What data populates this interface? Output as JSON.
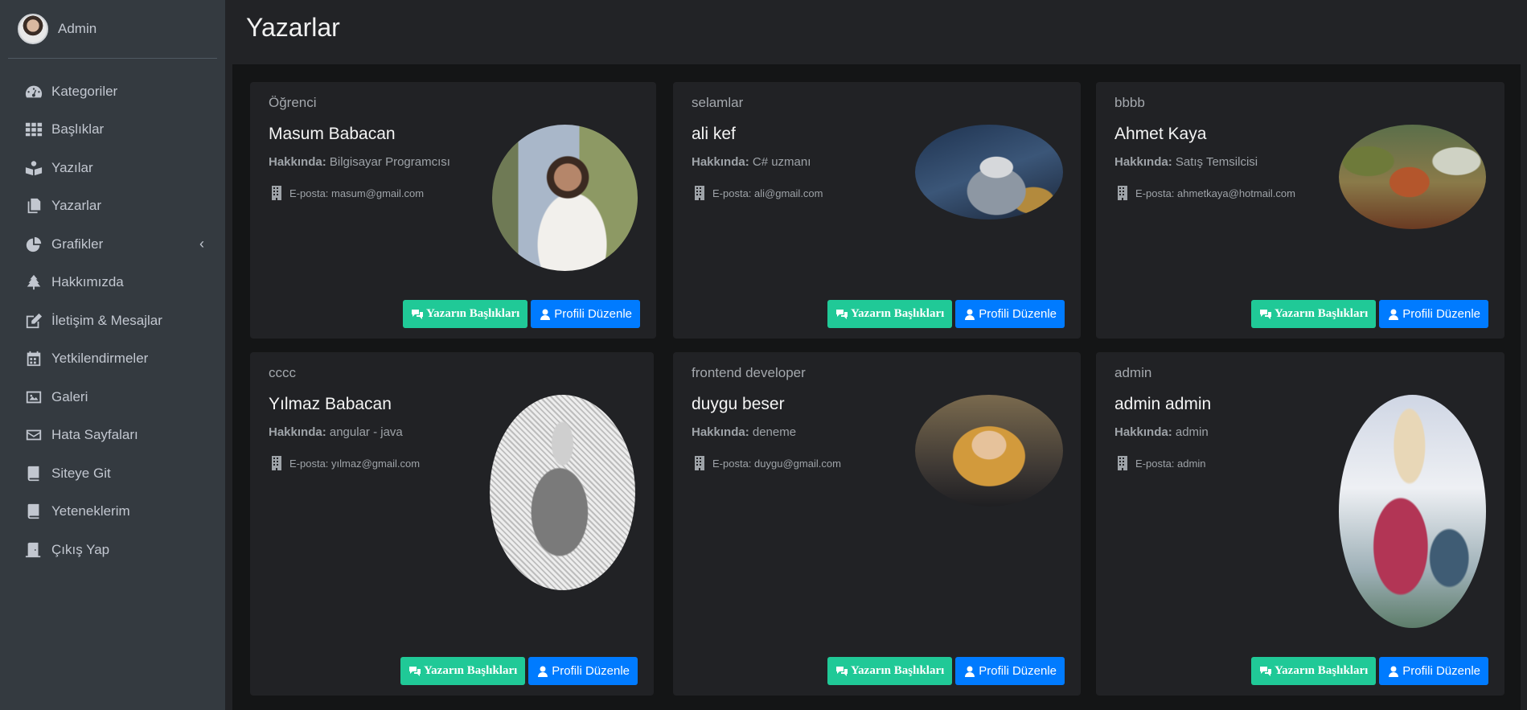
{
  "user": {
    "name": "Admin"
  },
  "nav": [
    {
      "label": "Kategoriler",
      "icon": "dashboard-icon"
    },
    {
      "label": "Başlıklar",
      "icon": "grid-icon"
    },
    {
      "label": "Yazılar",
      "icon": "book-reader-icon"
    },
    {
      "label": "Yazarlar",
      "icon": "copy-icon"
    },
    {
      "label": "Grafikler",
      "icon": "chart-pie-icon",
      "chevron": "‹"
    },
    {
      "label": "Hakkımızda",
      "icon": "tree-icon"
    },
    {
      "label": "İletişim & Mesajlar",
      "icon": "edit-icon"
    },
    {
      "label": "Yetkilendirmeler",
      "icon": "calendar-icon"
    },
    {
      "label": "Galeri",
      "icon": "image-icon"
    },
    {
      "label": "Hata Sayfaları",
      "icon": "envelope-icon"
    },
    {
      "label": "Siteye Git",
      "icon": "book-icon"
    },
    {
      "label": "Yeteneklerim",
      "icon": "book-icon"
    },
    {
      "label": "Çıkış Yap",
      "icon": "door-icon"
    }
  ],
  "page": {
    "title": "Yazarlar"
  },
  "labels": {
    "about": "Hakkında:",
    "email_prefix": "E-posta: ",
    "btn_titles": "Yazarın Başlıkları",
    "btn_edit": "Profili Düzenle"
  },
  "writers": [
    {
      "header": "Öğrenci",
      "name": "Masum Babacan",
      "about": "Bilgisayar Programcısı",
      "email": "masum@gmail.com"
    },
    {
      "header": "selamlar",
      "name": "ali kef",
      "about": "C# uzmanı",
      "email": "ali@gmail.com"
    },
    {
      "header": "bbbb",
      "name": "Ahmet Kaya",
      "about": "Satış Temsilcisi",
      "email": "ahmetkaya@hotmail.com"
    },
    {
      "header": "cccc",
      "name": "Yılmaz Babacan",
      "about": "angular - java",
      "email": "yılmaz@gmail.com"
    },
    {
      "header": "frontend developer",
      "name": "duygu beser",
      "about": "deneme",
      "email": "duygu@gmail.com"
    },
    {
      "header": "admin",
      "name": "admin admin",
      "about": "admin",
      "email": "admin"
    }
  ],
  "colors": {
    "sidebar": "#343a40",
    "content": "#141516",
    "card": "#212225",
    "green": "#20c997",
    "blue": "#007bff"
  }
}
